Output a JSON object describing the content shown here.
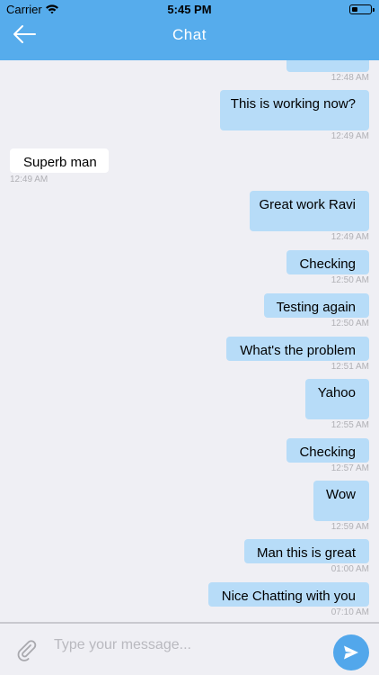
{
  "status_bar": {
    "carrier": "Carrier",
    "time": "5:45 PM"
  },
  "nav": {
    "title": "Chat"
  },
  "messages": [
    {
      "text": "",
      "time": "12:48 AM",
      "dir": "out"
    },
    {
      "text": "This is working now?",
      "time": "12:49 AM",
      "dir": "out"
    },
    {
      "text": "Superb man",
      "time": "12:49 AM",
      "dir": "in"
    },
    {
      "text": "Great work Ravi",
      "time": "12:49 AM",
      "dir": "out"
    },
    {
      "text": "Checking",
      "time": "12:50 AM",
      "dir": "out"
    },
    {
      "text": "Testing again",
      "time": "12:50 AM",
      "dir": "out"
    },
    {
      "text": "What's the problem",
      "time": "12:51 AM",
      "dir": "out"
    },
    {
      "text": "Yahoo",
      "time": "12:55 AM",
      "dir": "out"
    },
    {
      "text": "Checking",
      "time": "12:57 AM",
      "dir": "out"
    },
    {
      "text": "Wow",
      "time": "12:59 AM",
      "dir": "out"
    },
    {
      "text": "Man this is great",
      "time": "01:00 AM",
      "dir": "out"
    },
    {
      "text": "Nice Chatting with you",
      "time": "07:10 AM",
      "dir": "out"
    }
  ],
  "composer": {
    "placeholder": "Type your message..."
  },
  "colors": {
    "header": "#56acec",
    "outgoing_bubble": "#b7dcf8",
    "incoming_bubble": "#ffffff",
    "send_button": "#52a7eb",
    "background": "#efeff4"
  },
  "icons": {
    "back": "arrow-left-icon",
    "attach": "paperclip-icon",
    "send": "send-icon",
    "wifi": "wifi-icon",
    "battery": "battery-icon"
  }
}
